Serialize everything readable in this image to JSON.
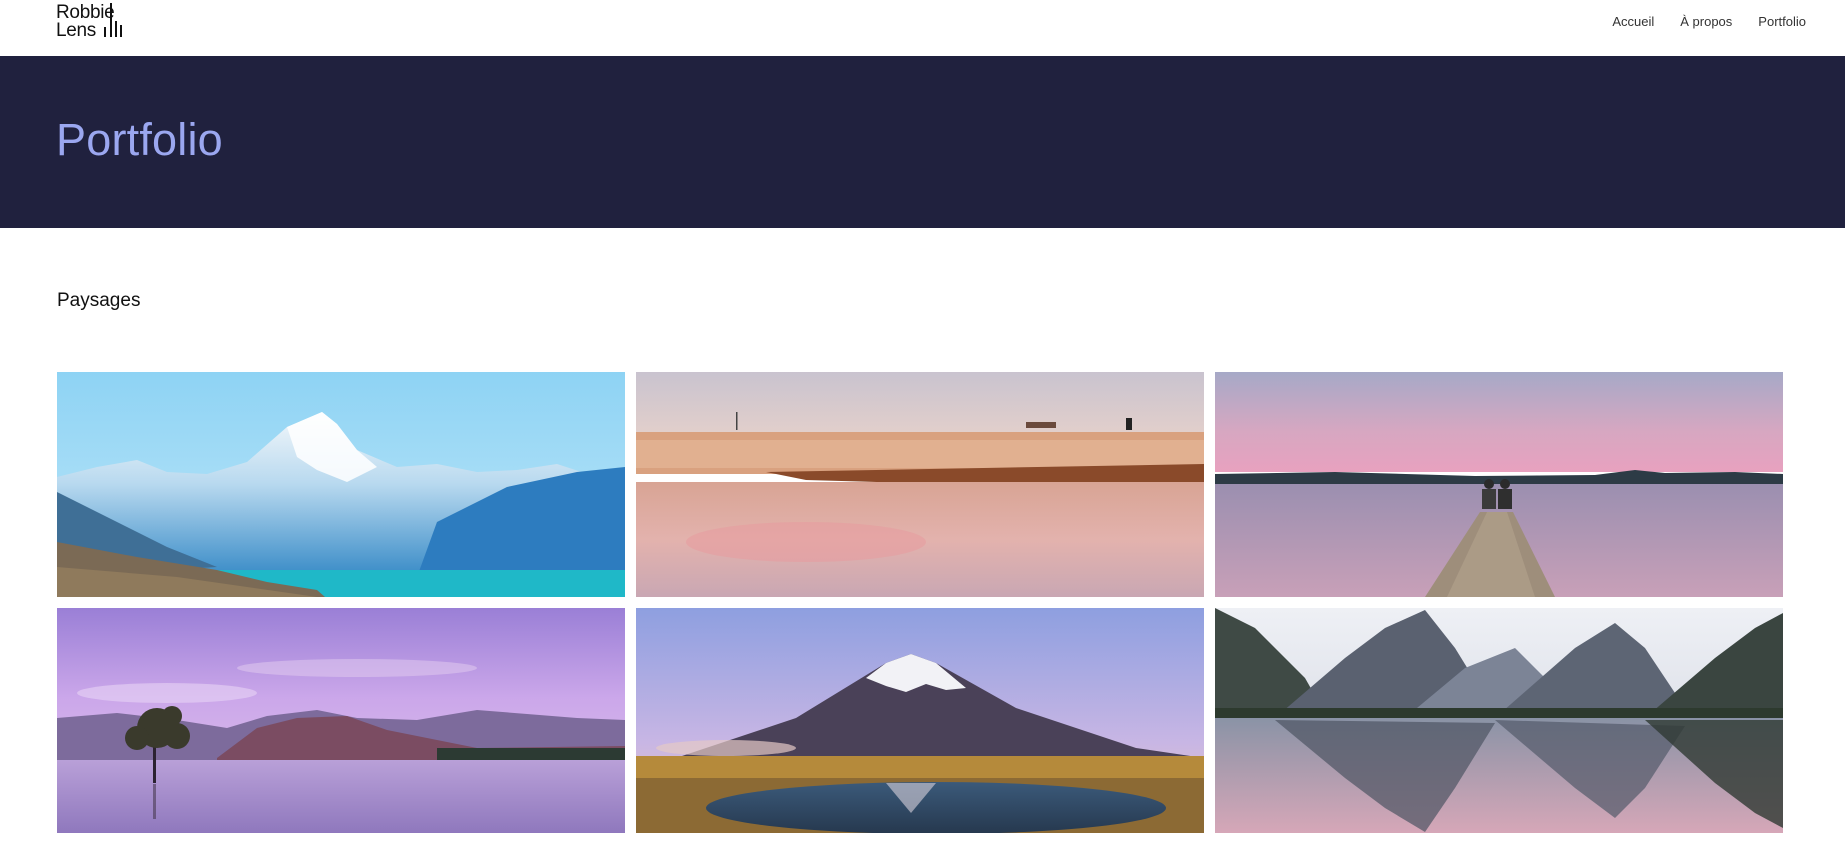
{
  "header": {
    "logo": {
      "line1": "Robbie",
      "line2": "Lens"
    },
    "nav": [
      {
        "label": "Accueil"
      },
      {
        "label": "À propos"
      },
      {
        "label": "Portfolio"
      }
    ]
  },
  "hero": {
    "title": "Portfolio"
  },
  "main": {
    "section_title": "Paysages",
    "photos": [
      {
        "subject": "snowy-mountain-lake"
      },
      {
        "subject": "pink-beach-reflection"
      },
      {
        "subject": "couple-on-jetty-dusk"
      },
      {
        "subject": "lone-tree-in-lake"
      },
      {
        "subject": "snowcapped-volcano-reflection"
      },
      {
        "subject": "fjord-peaks-reflection"
      }
    ]
  },
  "colors": {
    "hero_bg": "#20213e",
    "hero_title": "#9ba7f0",
    "page_bg": "#ffffff",
    "text": "#111111"
  }
}
